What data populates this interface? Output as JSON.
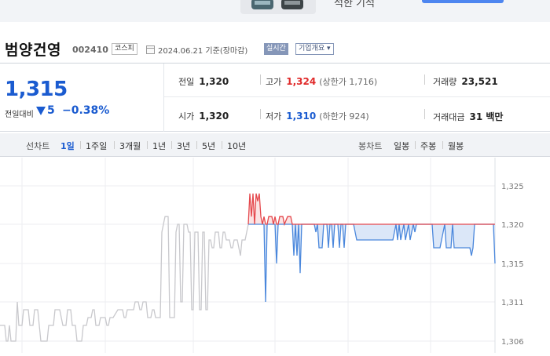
{
  "banner": {
    "text": "석한 기석"
  },
  "header": {
    "name": "범양건영",
    "code": "002410",
    "market": "코스피",
    "date": "2024.06.21 기준(장마감)",
    "realtime": "실시간",
    "company_info": "기업개요 ▾"
  },
  "price": {
    "current": "1,315",
    "change_label": "전일대비",
    "change_abs": "5",
    "change_pct": "−0.38%"
  },
  "stats": {
    "prev_close": {
      "label": "전일",
      "value": "1,320"
    },
    "high": {
      "label": "고가",
      "value": "1,324",
      "sub": "(상한가 1,716)"
    },
    "volume": {
      "label": "거래량",
      "value": "23,521"
    },
    "open": {
      "label": "시가",
      "value": "1,320"
    },
    "low": {
      "label": "저가",
      "value": "1,310",
      "sub": "(하한가 924)"
    },
    "amount": {
      "label": "거래대금",
      "value": "31 백만"
    }
  },
  "tabs": {
    "line_label": "선차트",
    "line_periods": [
      "1일",
      "1주일",
      "3개월",
      "1년",
      "3년",
      "5년",
      "10년"
    ],
    "candle_label": "봉차트",
    "candle_periods": [
      "일봉",
      "주봉",
      "월봉"
    ]
  },
  "colors": {
    "accent_blue": "#1a5bd0",
    "up_red": "#e02a2a",
    "fill_blue": "#dbe7f8"
  },
  "chart_data": {
    "type": "line",
    "title": "",
    "xlabel": "",
    "ylabel": "",
    "ylim": [
      1305.5,
      1326
    ],
    "yticks": [
      "1,325",
      "1,320",
      "1,315",
      "1,311",
      "1,306"
    ],
    "ytick_values": [
      1325,
      1320,
      1315,
      1311,
      1306
    ],
    "baseline": 1320,
    "series": [
      {
        "segment": "previous",
        "color": "#c8c8cc",
        "points": [
          [
            0,
            1308
          ],
          [
            6,
            1308
          ],
          [
            8,
            1306
          ],
          [
            10,
            1306
          ],
          [
            12,
            1308
          ],
          [
            14,
            1306
          ],
          [
            20,
            1306
          ],
          [
            22,
            1311
          ],
          [
            24,
            1308
          ],
          [
            28,
            1308
          ],
          [
            30,
            1310
          ],
          [
            36,
            1310
          ],
          [
            38,
            1308
          ],
          [
            42,
            1308
          ],
          [
            44,
            1310
          ],
          [
            48,
            1310
          ],
          [
            52,
            1306
          ],
          [
            60,
            1306
          ],
          [
            62,
            1308
          ],
          [
            68,
            1308
          ],
          [
            70,
            1310
          ],
          [
            76,
            1310
          ],
          [
            80,
            1308
          ],
          [
            84,
            1308
          ],
          [
            86,
            1310
          ],
          [
            90,
            1310
          ],
          [
            92,
            1308
          ],
          [
            96,
            1308
          ],
          [
            98,
            1306
          ],
          [
            104,
            1306
          ],
          [
            106,
            1308
          ],
          [
            110,
            1308
          ],
          [
            112,
            1309
          ],
          [
            116,
            1309
          ],
          [
            118,
            1310
          ],
          [
            120,
            1310
          ],
          [
            122,
            1308
          ],
          [
            126,
            1308
          ],
          [
            128,
            1309
          ],
          [
            134,
            1309
          ],
          [
            136,
            1308
          ],
          [
            138,
            1308
          ],
          [
            140,
            1309
          ],
          [
            144,
            1309
          ],
          [
            150,
            1310
          ],
          [
            156,
            1310
          ],
          [
            158,
            1309
          ],
          [
            160,
            1309
          ],
          [
            162,
            1310
          ],
          [
            170,
            1310
          ],
          [
            172,
            1311
          ],
          [
            176,
            1311
          ],
          [
            178,
            1310
          ],
          [
            180,
            1310
          ],
          [
            182,
            1311
          ],
          [
            186,
            1311
          ],
          [
            188,
            1309
          ],
          [
            192,
            1309
          ],
          [
            194,
            1310
          ],
          [
            196,
            1310
          ],
          [
            198,
            1309
          ],
          [
            204,
            1309
          ],
          [
            206,
            1319
          ],
          [
            208,
            1320
          ],
          [
            210,
            1321
          ],
          [
            214,
            1321
          ],
          [
            216,
            1309
          ],
          [
            222,
            1309
          ],
          [
            224,
            1319
          ],
          [
            226,
            1320
          ],
          [
            228,
            1320
          ],
          [
            230,
            1311
          ],
          [
            232,
            1311
          ],
          [
            234,
            1320
          ],
          [
            238,
            1320
          ],
          [
            240,
            1319
          ],
          [
            242,
            1319
          ],
          [
            244,
            1310
          ],
          [
            246,
            1310
          ],
          [
            248,
            1319
          ],
          [
            252,
            1319
          ],
          [
            254,
            1310
          ],
          [
            256,
            1310
          ],
          [
            258,
            1319
          ],
          [
            260,
            1319
          ],
          [
            262,
            1310
          ],
          [
            264,
            1310
          ],
          [
            266,
            1318
          ],
          [
            268,
            1318
          ],
          [
            270,
            1317
          ],
          [
            272,
            1317
          ],
          [
            274,
            1319
          ],
          [
            278,
            1319
          ],
          [
            280,
            1317
          ],
          [
            282,
            1317
          ],
          [
            284,
            1319
          ],
          [
            286,
            1319
          ],
          [
            288,
            1318
          ],
          [
            292,
            1318
          ],
          [
            294,
            1317
          ],
          [
            296,
            1317
          ],
          [
            298,
            1318
          ],
          [
            302,
            1318
          ],
          [
            306,
            1316
          ],
          [
            308,
            1318
          ],
          [
            312,
            1318
          ],
          [
            316,
            1320
          ]
        ]
      },
      {
        "segment": "today",
        "points": [
          [
            316,
            1320
          ],
          [
            318,
            1324
          ],
          [
            320,
            1321
          ],
          [
            322,
            1324
          ],
          [
            324,
            1320
          ],
          [
            326,
            1324
          ],
          [
            328,
            1323
          ],
          [
            330,
            1324
          ],
          [
            332,
            1321
          ],
          [
            334,
            1320
          ],
          [
            336,
            1321
          ],
          [
            338,
            1311
          ],
          [
            340,
            1320
          ],
          [
            342,
            1321
          ],
          [
            346,
            1321
          ],
          [
            348,
            1320
          ],
          [
            350,
            1321
          ],
          [
            352,
            1315
          ],
          [
            354,
            1320
          ],
          [
            356,
            1321
          ],
          [
            360,
            1321
          ],
          [
            362,
            1320
          ],
          [
            366,
            1321
          ],
          [
            370,
            1321
          ],
          [
            372,
            1320
          ],
          [
            374,
            1316
          ],
          [
            376,
            1320
          ],
          [
            378,
            1316
          ],
          [
            380,
            1320
          ],
          [
            382,
            1314
          ],
          [
            384,
            1320
          ],
          [
            400,
            1320
          ],
          [
            402,
            1319
          ],
          [
            404,
            1320
          ],
          [
            406,
            1317
          ],
          [
            410,
            1317
          ],
          [
            412,
            1320
          ],
          [
            416,
            1320
          ],
          [
            418,
            1317
          ],
          [
            420,
            1320
          ],
          [
            422,
            1320
          ],
          [
            424,
            1317
          ],
          [
            426,
            1320
          ],
          [
            430,
            1320
          ],
          [
            432,
            1317
          ],
          [
            434,
            1320
          ],
          [
            436,
            1320
          ],
          [
            438,
            1317
          ],
          [
            440,
            1320
          ],
          [
            450,
            1320
          ],
          [
            454,
            1318
          ],
          [
            460,
            1318
          ],
          [
            470,
            1318
          ],
          [
            480,
            1318
          ],
          [
            500,
            1318
          ],
          [
            504,
            1320
          ],
          [
            506,
            1318
          ],
          [
            508,
            1320
          ],
          [
            510,
            1318
          ],
          [
            514,
            1320
          ],
          [
            516,
            1318
          ],
          [
            520,
            1320
          ],
          [
            522,
            1318
          ],
          [
            526,
            1320
          ],
          [
            528,
            1319
          ],
          [
            530,
            1320
          ],
          [
            550,
            1320
          ],
          [
            552,
            1317
          ],
          [
            560,
            1317
          ],
          [
            566,
            1320
          ],
          [
            568,
            1317
          ],
          [
            574,
            1317
          ],
          [
            576,
            1320
          ],
          [
            578,
            1317
          ],
          [
            598,
            1317
          ],
          [
            600,
            1316
          ],
          [
            602,
            1317
          ],
          [
            604,
            1320
          ],
          [
            628,
            1320
          ],
          [
            630,
            1315
          ]
        ]
      }
    ]
  }
}
